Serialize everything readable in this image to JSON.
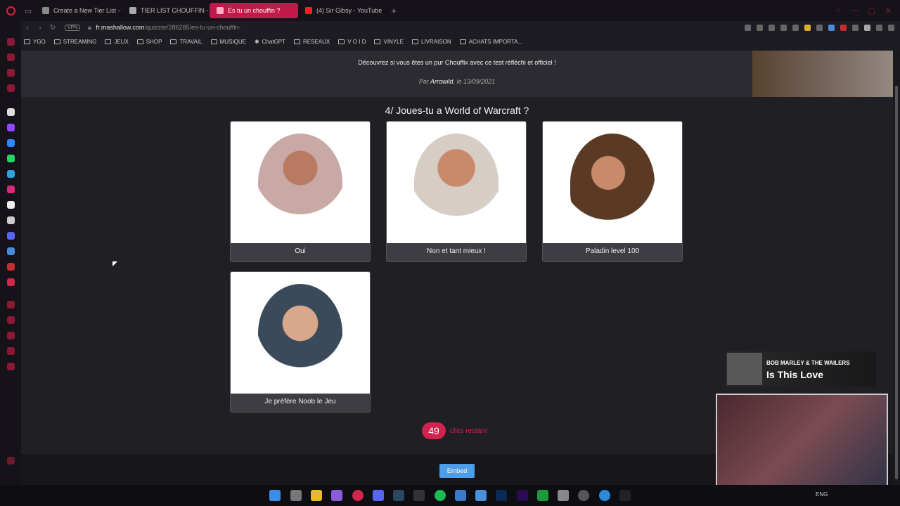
{
  "tabs": [
    {
      "title": "Create a New Tier List - T",
      "active": false,
      "color": "#888888"
    },
    {
      "title": "TIER LIST CHOUFFIN - Ti",
      "active": false,
      "color": "#aaaaaa"
    },
    {
      "title": "Es tu un chouffin ?",
      "active": true,
      "color": "#e0407a"
    },
    {
      "title": "(4) Sir Gibsy - YouTube",
      "active": false,
      "color": "#ff0000"
    }
  ],
  "address": {
    "vpn": "VPN",
    "domain": "fr.mashallow.com",
    "path": "/quizzer/286285/es-tu-un-chouffin-"
  },
  "bookmarks": [
    "YGO",
    "STREAMING",
    "JEUX",
    "SHOP",
    "TRAVAIL",
    "MUSIQUE",
    "ChatGPT",
    "RESEAUX",
    "V O I D",
    "VINYLE",
    "LIVRAISON",
    "ACHATS IMPORTA..."
  ],
  "page": {
    "description": "Découvrez si vous êtes un pur Chouffix avec ce test réfléchi et officiel !",
    "by_prefix": "Par",
    "author": "Arrowild",
    "date_text": ", le 13/09/2021",
    "question": "4/ Joues-tu a World of Warcraft ?",
    "answers": [
      {
        "label": "Oui"
      },
      {
        "label": "Non et tant mieux !"
      },
      {
        "label": "Paladin level 100"
      },
      {
        "label": "Je préfère Noob le Jeu"
      }
    ],
    "clicks_count": "49",
    "clicks_label": "clics restant",
    "embed_label": "Embed"
  },
  "now_playing": {
    "artist": "BOB MARLEY & THE WAILERS",
    "song": "Is This Love"
  },
  "taskbar": {
    "lang": "ENG"
  },
  "colors": {
    "accent": "#c2184a",
    "clicks": "#d0234f",
    "embed": "#4e9de8"
  }
}
